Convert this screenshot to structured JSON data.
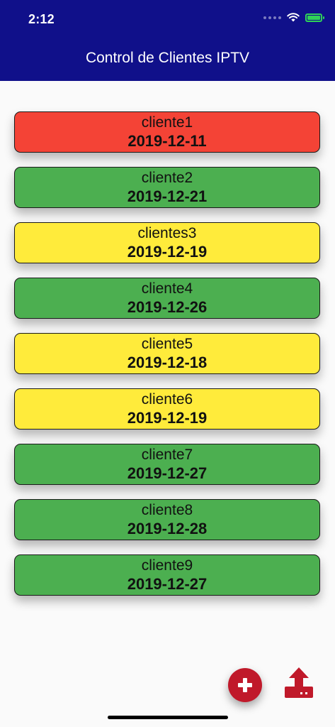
{
  "status_bar": {
    "time": "2:12"
  },
  "header": {
    "title": "Control de Clientes IPTV",
    "background": "#10108a"
  },
  "clients": [
    {
      "name": "cliente1",
      "date": "2019-12-11",
      "color": "#f44336"
    },
    {
      "name": "cliente2",
      "date": "2019-12-21",
      "color": "#4caf50"
    },
    {
      "name": "clientes3",
      "date": "2019-12-19",
      "color": "#ffeb3b"
    },
    {
      "name": "cliente4",
      "date": "2019-12-26",
      "color": "#4caf50"
    },
    {
      "name": "cliente5",
      "date": "2019-12-18",
      "color": "#ffeb3b"
    },
    {
      "name": "cliente6",
      "date": "2019-12-19",
      "color": "#ffeb3b"
    },
    {
      "name": "cliente7",
      "date": "2019-12-27",
      "color": "#4caf50"
    },
    {
      "name": "cliente8",
      "date": "2019-12-28",
      "color": "#4caf50"
    },
    {
      "name": "cliente9",
      "date": "2019-12-27",
      "color": "#4caf50"
    }
  ],
  "actions": {
    "add_icon": "plus-circle-icon",
    "upload_icon": "upload-icon",
    "accent": "#c0192a"
  }
}
